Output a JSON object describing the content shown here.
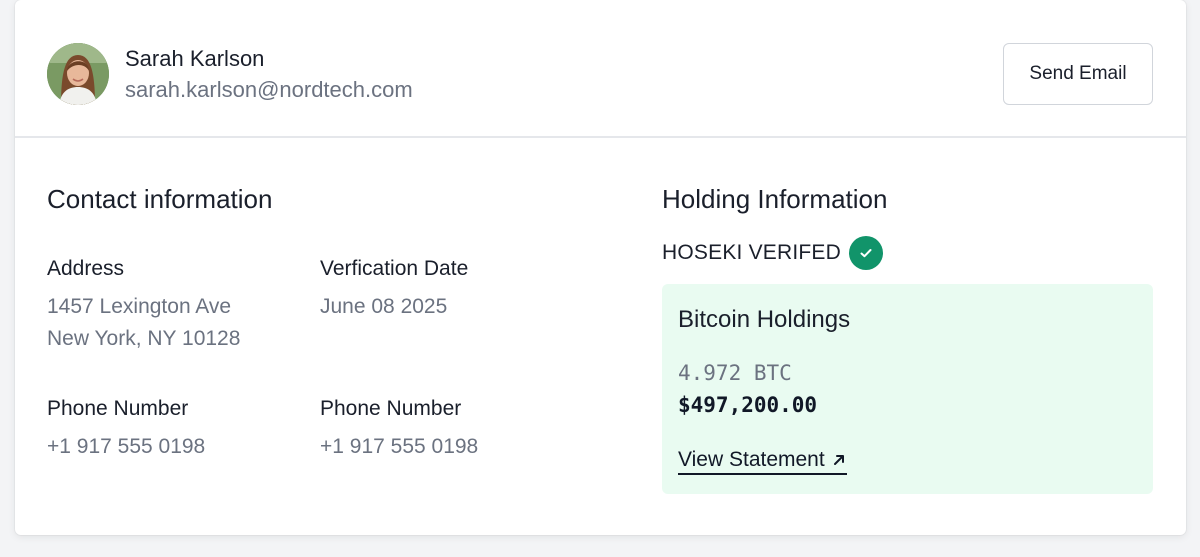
{
  "user": {
    "name": "Sarah Karlson",
    "email": "sarah.karlson@nordtech.com"
  },
  "header": {
    "send_email_label": "Send Email"
  },
  "contact": {
    "title": "Contact information",
    "address_label": "Address",
    "address_line1": "1457 Lexington Ave",
    "address_line2": "New York, NY 10128",
    "verification_label": "Verfication Date",
    "verification_value": "June 08 2025",
    "phone1_label": "Phone Number",
    "phone1_value": "+1 917 555 0198",
    "phone2_label": "Phone Number",
    "phone2_value": "+1 917 555 0198"
  },
  "holding": {
    "title": "Holding Information",
    "verified_text": "HOSEKI VERIFED",
    "card_title": "Bitcoin Holdings",
    "btc_amount": "4.972 BTC",
    "usd_amount": "$497,200.00",
    "view_statement_label": "View Statement"
  },
  "icons": {
    "verified": "check-circle-icon",
    "external": "arrow-up-right-icon"
  },
  "colors": {
    "verified_green": "#11946a",
    "holdings_bg": "#e9fbf1",
    "muted_text": "#6b7280"
  }
}
